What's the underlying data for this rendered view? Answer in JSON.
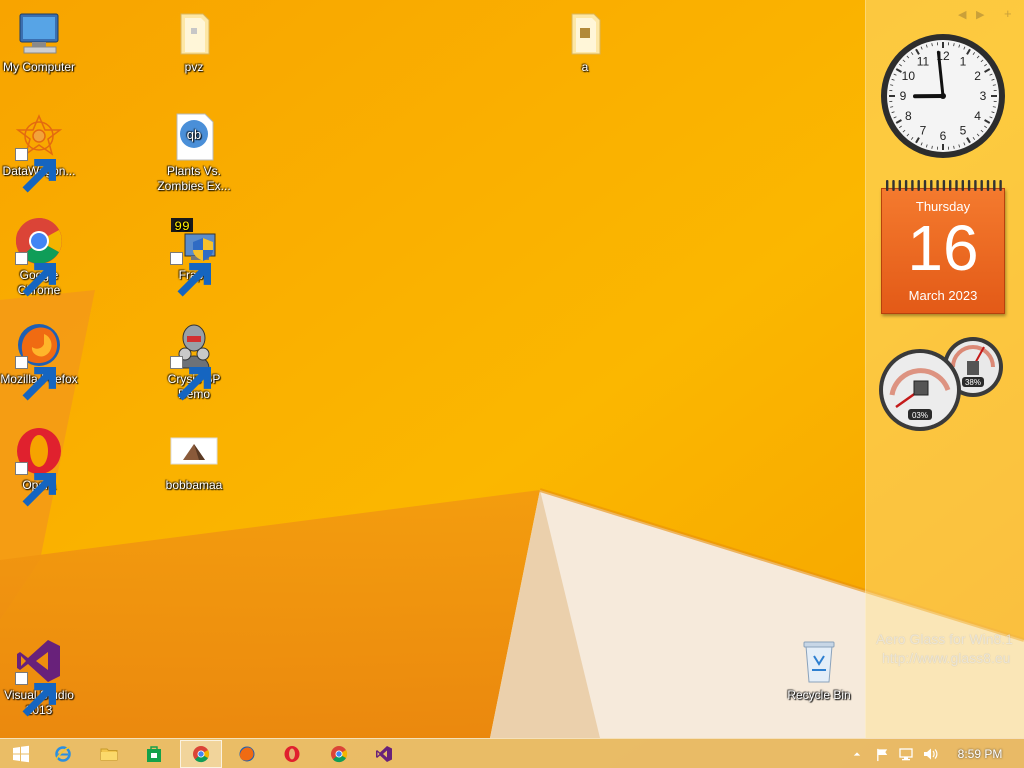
{
  "desktop": {
    "icons": [
      {
        "label": "My Computer"
      },
      {
        "label": "DataWagon..."
      },
      {
        "label": "Google Chrome"
      },
      {
        "label": "Mozilla Firefox"
      },
      {
        "label": "Opera"
      },
      {
        "label": "Visual Studio 2013"
      },
      {
        "label": "pvz"
      },
      {
        "label": "Plants Vs. Zombies Ex..."
      },
      {
        "label": "Fraps"
      },
      {
        "label": "Crysis SP Demo"
      },
      {
        "label": "bobbamaa"
      },
      {
        "label": "a"
      },
      {
        "label": "Recycle Bin"
      }
    ]
  },
  "gadgets": {
    "clock": {
      "hour": 8,
      "minute": 59
    },
    "calendar": {
      "weekday": "Thursday",
      "day": "16",
      "month_year": "March 2023"
    },
    "meter": {
      "cpu_label": "03%",
      "memory_label": "38%"
    }
  },
  "watermark": {
    "line1": "Aero Glass for Win8.1",
    "line2": "http://www.glass8.eu"
  },
  "taskbar": {
    "pinned": [
      {
        "name": "start"
      },
      {
        "name": "internet-explorer"
      },
      {
        "name": "file-explorer"
      },
      {
        "name": "store"
      },
      {
        "name": "chrome",
        "active": true
      },
      {
        "name": "firefox"
      },
      {
        "name": "opera"
      },
      {
        "name": "chrome"
      },
      {
        "name": "visual-studio"
      }
    ],
    "time": "8:59 PM"
  },
  "colors": {
    "wallpaper": "#f6a300",
    "calendar": "#e8621e",
    "opera": "#e0212e",
    "visual_studio": "#68217a"
  }
}
